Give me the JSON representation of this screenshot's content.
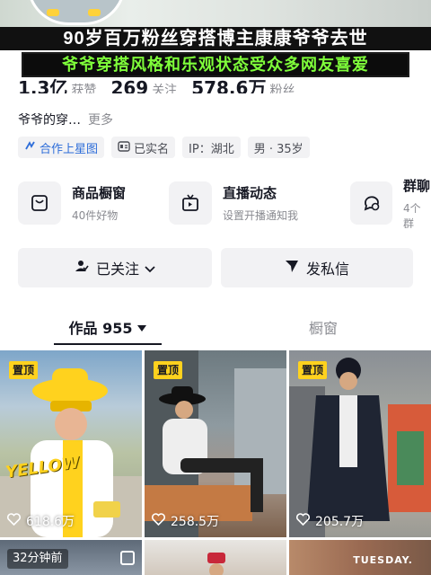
{
  "overlay": {
    "headline": "90岁百万粉丝穿搭博主康康爷爷去世",
    "subline": "爷爷穿搭风格和乐观状态受众多网友喜爱"
  },
  "profile": {
    "stats": [
      {
        "value": "1.3亿",
        "label": "获赞"
      },
      {
        "value": "269",
        "label": "关注"
      },
      {
        "value": "578.6万",
        "label": "粉丝"
      }
    ],
    "bio": "爷爷的穿…",
    "bio_more": "更多",
    "tags": [
      {
        "label": "合作上星图",
        "icon": "star-map-icon"
      },
      {
        "label": "已实名",
        "icon": "id-card-icon"
      },
      {
        "label": "IP：湖北"
      },
      {
        "label": "男 · 35岁"
      }
    ]
  },
  "features": [
    {
      "title": "商品橱窗",
      "subtitle": "40件好物",
      "icon": "shopping-bag-icon"
    },
    {
      "title": "直播动态",
      "subtitle": "设置开播通知我",
      "icon": "tv-icon"
    },
    {
      "title": "群聊",
      "subtitle": "4个群",
      "icon": "chat-icon"
    }
  ],
  "actions": {
    "follow_label": "已关注",
    "message_label": "发私信"
  },
  "tabs": {
    "works_label": "作品 955",
    "showcase_label": "橱窗"
  },
  "grid": [
    {
      "pinned": "置顶",
      "likes": "618.6万",
      "overlay_text": "YELLOW"
    },
    {
      "pinned": "置顶",
      "likes": "258.5万"
    },
    {
      "pinned": "置顶",
      "likes": "205.7万"
    },
    {
      "time_ago": "32分钟前"
    },
    {},
    {
      "overlay_text": "TUESDAY."
    }
  ],
  "colors": {
    "subline_green": "#7fff3a",
    "pin_yellow": "#ffd21e",
    "tag_blue": "#2d6dd9",
    "muted_gray": "#8a8b91"
  }
}
